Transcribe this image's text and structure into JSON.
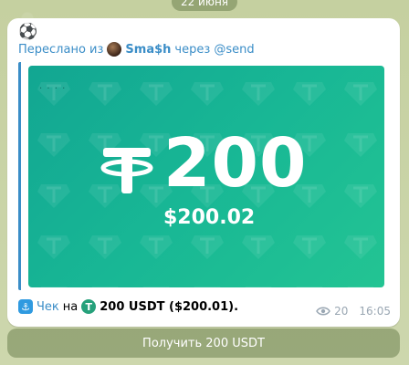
{
  "date": "22 июня",
  "message": {
    "emoji": "⚽",
    "forward": {
      "prefix": "Переслано из",
      "username": "Sma$h",
      "via": "через @send"
    },
    "card": {
      "dots": "· · · ·",
      "amount": "200",
      "fiat": "$200.02"
    },
    "info": {
      "link": "Чек",
      "on": "на",
      "text": "200 USDT ($200.01)."
    },
    "views": "20",
    "time": "16:05"
  },
  "button": {
    "label": "Получить 200 USDT"
  },
  "colors": {
    "accent": "#3a8dc7",
    "card_green": "#1bb896",
    "usdt": "#26a17b"
  },
  "icons": {
    "views": "eye-icon",
    "bot": "send-bot-icon",
    "token": "usdt-icon"
  }
}
